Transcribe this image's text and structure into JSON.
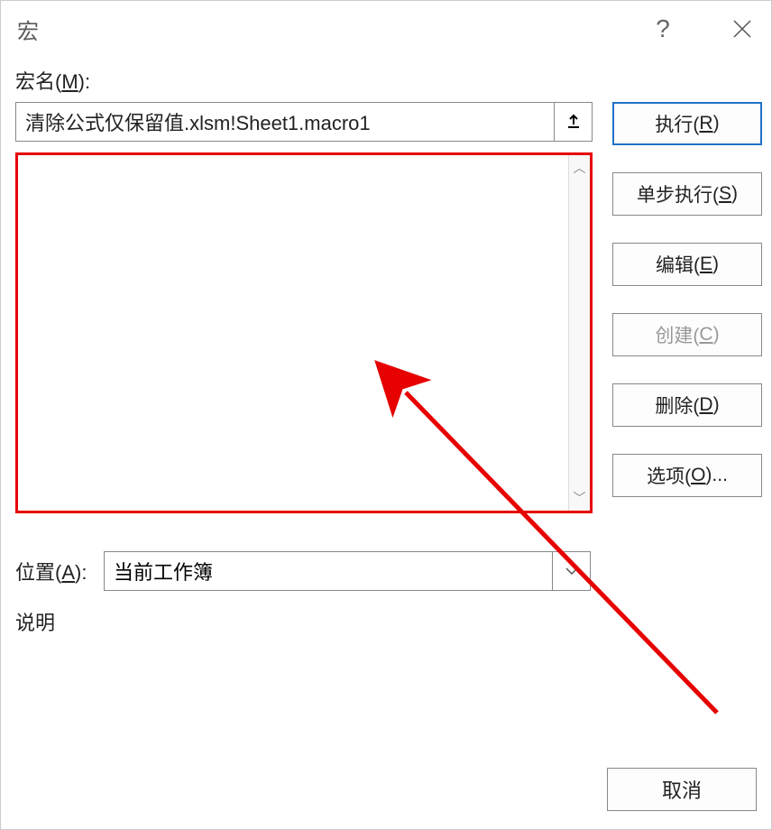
{
  "dialog": {
    "title": "宏",
    "help_symbol": "?",
    "macro_name_label": "宏名(M):",
    "macro_name_value": "清除公式仅保留值.xlsm!Sheet1.macro1",
    "location_label": "位置(A):",
    "location_value": "当前工作簿",
    "description_label": "说明"
  },
  "buttons": {
    "run": "执行(R)",
    "step": "单步执行(S)",
    "edit": "编辑(E)",
    "create": "创建(C)",
    "delete": "删除(D)",
    "options": "选项(O)...",
    "cancel": "取消"
  },
  "annotation": {
    "arrow_color": "#e60000"
  }
}
